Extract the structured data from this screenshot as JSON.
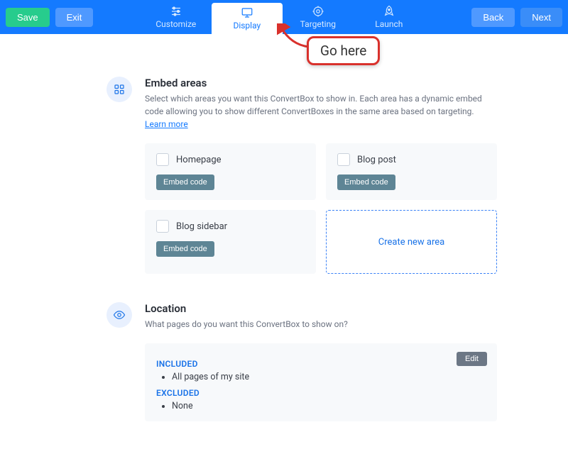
{
  "topbar": {
    "save": "Save",
    "exit": "Exit",
    "back": "Back",
    "next": "Next",
    "steps": {
      "customize": "Customize",
      "display": "Display",
      "targeting": "Targeting",
      "launch": "Launch"
    }
  },
  "annotation": {
    "label": "Go here"
  },
  "embed": {
    "title": "Embed areas",
    "desc_prefix": "Select which areas you want this ConvertBox to show in. Each area has a dynamic embed code allowing you to show different ConvertBoxes in the same area based on targeting. ",
    "learn_more": "Learn more",
    "areas": [
      {
        "label": "Homepage",
        "button": "Embed code"
      },
      {
        "label": "Blog post",
        "button": "Embed code"
      },
      {
        "label": "Blog sidebar",
        "button": "Embed code"
      }
    ],
    "create_new": "Create new area"
  },
  "location": {
    "title": "Location",
    "desc": "What pages do you want this ConvertBox to show on?",
    "included_label": "INCLUDED",
    "included_item": "All pages of my site",
    "excluded_label": "EXCLUDED",
    "excluded_item": "None",
    "edit": "Edit"
  }
}
